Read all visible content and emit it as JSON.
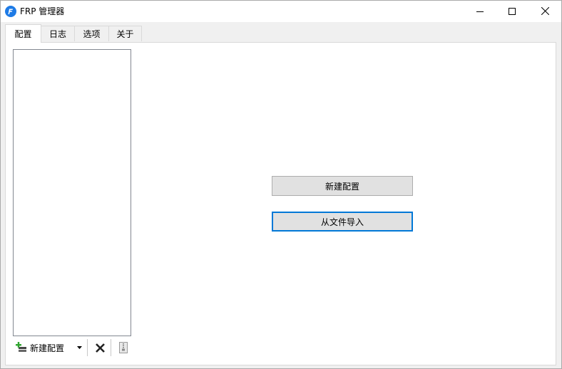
{
  "window": {
    "title": "FRP 管理器",
    "controls": [
      "minimize-icon",
      "maximize-icon",
      "close-icon"
    ]
  },
  "tabs": [
    {
      "label": "配置",
      "active": true
    },
    {
      "label": "日志",
      "active": false
    },
    {
      "label": "选项",
      "active": false
    },
    {
      "label": "关于",
      "active": false
    }
  ],
  "main": {
    "new_config_label": "新建配置",
    "import_label": "从文件导入"
  },
  "toolbar": {
    "new_config_label": "新建配置",
    "icons": [
      "add-config-icon",
      "dropdown-arrow-icon",
      "delete-icon",
      "archive-icon"
    ]
  },
  "colors": {
    "focus_border": "#0078d7",
    "app_icon": "#1e7be6",
    "add_icon_green": "#2fa52f"
  }
}
